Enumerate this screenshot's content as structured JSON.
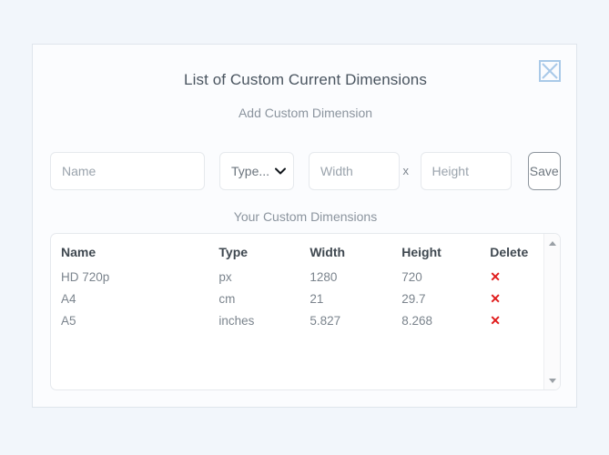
{
  "dialog": {
    "title": "List of Custom Current Dimensions",
    "close_icon": "close-box-icon",
    "add_section_label": "Add Custom Dimension",
    "list_section_label": "Your Custom Dimensions"
  },
  "form": {
    "name_placeholder": "Name",
    "name_value": "",
    "type_selected": "Type...",
    "type_chevron_icon": "chevron-down-icon",
    "width_placeholder": "Width",
    "width_value": "",
    "separator": "x",
    "height_placeholder": "Height",
    "height_value": "",
    "save_label": "Save"
  },
  "table": {
    "headers": [
      "Name",
      "Type",
      "Width",
      "Height",
      "Delete"
    ],
    "delete_icon": "✕",
    "rows": [
      {
        "name": "HD 720p",
        "type": "px",
        "width": "1280",
        "height": "720"
      },
      {
        "name": "A4",
        "type": "cm",
        "width": "21",
        "height": "29.7"
      },
      {
        "name": "A5",
        "type": "inches",
        "width": "5.827",
        "height": "8.268"
      }
    ]
  },
  "scrollbar": {
    "up_icon": "scroll-up-arrow-icon",
    "down_icon": "scroll-down-arrow-icon"
  },
  "colors": {
    "page_background": "#f2f6fb",
    "card_background": "#fbfcfe",
    "card_border": "#dfe5ec",
    "title_text": "#4a5560",
    "muted_text": "#8b949e",
    "close_border": "#a9c9e8",
    "delete_red": "#e01b1b"
  }
}
